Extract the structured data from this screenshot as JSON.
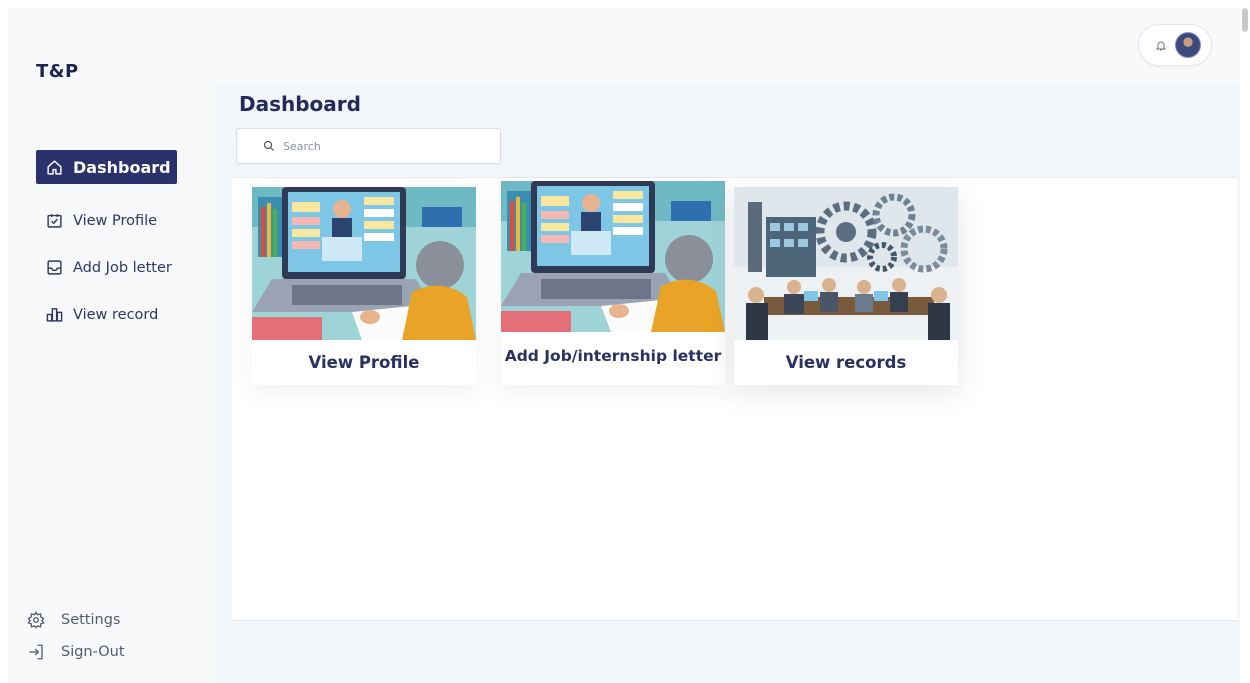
{
  "brand": "T&P",
  "sidebar": {
    "items": [
      {
        "label": "Dashboard",
        "icon": "home-icon",
        "active": true
      },
      {
        "label": "View Profile",
        "icon": "calendar-check-icon"
      },
      {
        "label": "Add Job letter",
        "icon": "inbox-icon"
      },
      {
        "label": "View record",
        "icon": "bar-chart-icon"
      }
    ],
    "bottom": [
      {
        "label": "Settings",
        "icon": "gear-icon"
      },
      {
        "label": "Sign-Out",
        "icon": "sign-out-icon"
      }
    ]
  },
  "header": {
    "page_title": "Dashboard",
    "search": {
      "placeholder": "Search",
      "value": ""
    }
  },
  "cards": [
    {
      "label": "View Profile",
      "image": "student-studying-illustration"
    },
    {
      "label": "Add Job/internship letter",
      "image": "student-studying-illustration"
    },
    {
      "label": "View records",
      "image": "industry-meeting-illustration"
    }
  ],
  "colors": {
    "accent": "#2b326b",
    "text": "#2a3160",
    "background": "#f3f6fa",
    "surface": "#ffffff"
  }
}
